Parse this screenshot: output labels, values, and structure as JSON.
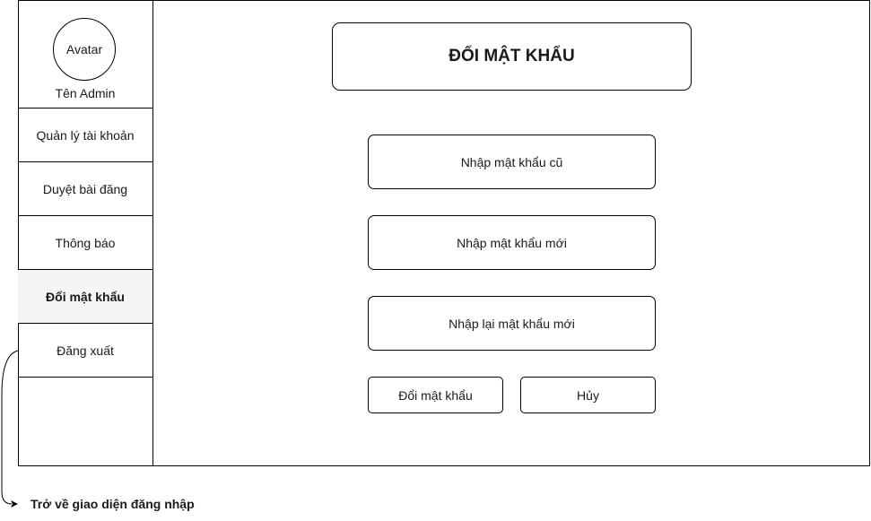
{
  "sidebar": {
    "avatar_label": "Avatar",
    "admin_name": "Tên Admin",
    "items": [
      {
        "label": "Quản lý tài khoản"
      },
      {
        "label": "Duyệt bài đăng"
      },
      {
        "label": "Thông báo"
      },
      {
        "label": "Đổi mật khẩu"
      },
      {
        "label": "Đăng xuất"
      }
    ]
  },
  "main": {
    "title": "ĐỔI MẬT KHẨU",
    "fields": {
      "old_password": "Nhập mật khẩu cũ",
      "new_password": "Nhập mật khẩu mới",
      "confirm_password": "Nhập lại mật khẩu mới"
    },
    "buttons": {
      "submit": "Đổi mật khẩu",
      "cancel": "Hủy"
    }
  },
  "annotation": {
    "back_to_login": "Trở về giao diện đăng nhập"
  }
}
